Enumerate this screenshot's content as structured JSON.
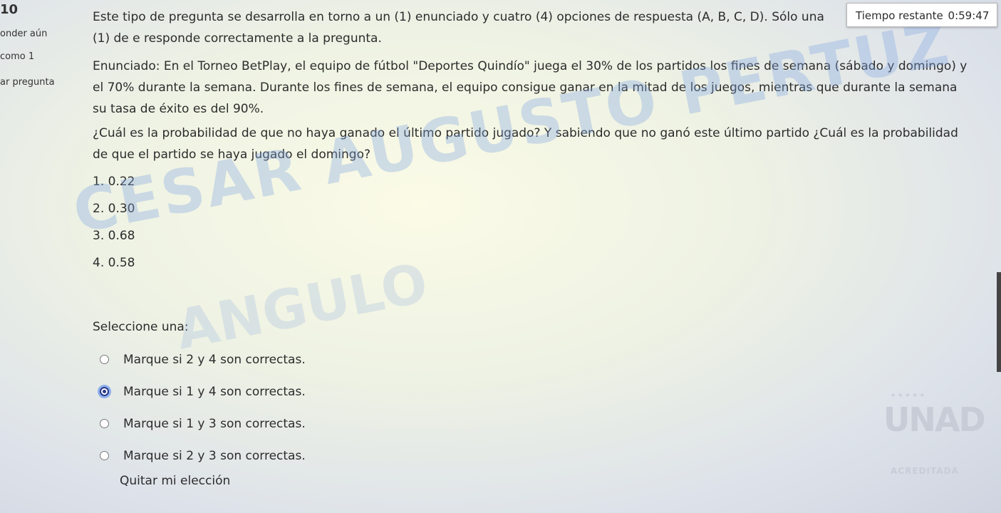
{
  "sidebar": {
    "question_number": "10",
    "status": "onder aún",
    "marks": "como 1",
    "flag": "ar pregunta"
  },
  "timer": {
    "label": "Tiempo restante",
    "value": "0:59:47"
  },
  "question": {
    "intro": "Este tipo de pregunta se desarrolla en torno a un (1) enunciado y cuatro (4) opciones de respuesta (A, B, C, D). Sólo una (1) de e responde correctamente a la pregunta.",
    "statement": "Enunciado: En el Torneo BetPlay, el equipo de fútbol \"Deportes Quindío\" juega el 30% de los partidos los fines de semana (sábado y domingo) y el 70% durante la semana. Durante los fines de semana, el equipo consigue ganar en la mitad de los juegos, mientras que durante la semana su tasa de éxito es del 90%.",
    "prompt": "¿Cuál es la probabilidad de que no haya ganado el último partido jugado? Y sabiendo que no ganó este último partido ¿Cuál es la probabilidad de que el partido se haya jugado el domingo?",
    "numbered": [
      "1. 0.22",
      "2. 0.30",
      "3. 0.68",
      "4. 0.58"
    ]
  },
  "answer": {
    "select_label": "Seleccione una:",
    "options": [
      {
        "label": "Marque si 2 y 4 son correctas.",
        "checked": false
      },
      {
        "label": "Marque si 1 y 4 son correctas.",
        "checked": true
      },
      {
        "label": "Marque si 1 y 3 son correctas.",
        "checked": false
      },
      {
        "label": "Marque si 2 y 3 son correctas.",
        "checked": false
      }
    ],
    "clear_label": "Quitar mi elección"
  },
  "watermark": {
    "line1": "CESAR AUGUSTO PERTUZ",
    "line2": "ANGULO"
  },
  "logo": {
    "word": "UNAD",
    "badge": "ACREDITADA"
  },
  "colors": {
    "radio_checked": "#2a3a8a",
    "radio_focus": "#8fb0ec"
  }
}
